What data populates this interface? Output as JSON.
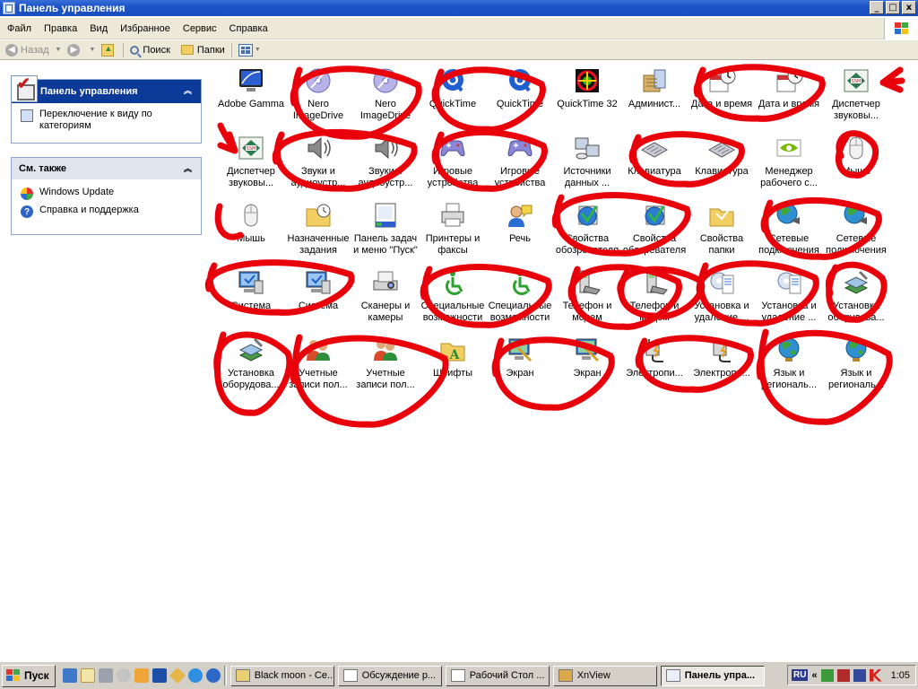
{
  "window": {
    "title": "Панель управления",
    "buttons": [
      "_",
      "□",
      "x"
    ]
  },
  "menu": [
    "Файл",
    "Правка",
    "Вид",
    "Избранное",
    "Сервис",
    "Справка"
  ],
  "toolbar": {
    "back_label": "Назад",
    "search_label": "Поиск",
    "folders_label": "Папки"
  },
  "left_pane": {
    "panel1": {
      "title": "Панель управления",
      "task": "Переключение к виду по категориям"
    },
    "panel2": {
      "title": "См. также",
      "links": [
        "Windows Update",
        "Справка и поддержка"
      ]
    }
  },
  "items": [
    {
      "label": "Adobe Gamma",
      "icon": "monitor-gamma-icon"
    },
    {
      "label": "Nero\nImageDrive",
      "icon": "nero-disc-icon"
    },
    {
      "label": "Nero\nImageDrive",
      "icon": "nero-disc-icon"
    },
    {
      "label": "QuickTime",
      "icon": "quicktime-icon"
    },
    {
      "label": "QuickTime",
      "icon": "quicktime-icon"
    },
    {
      "label": "QuickTime 32",
      "icon": "quicktime32-icon"
    },
    {
      "label": "Админист...",
      "icon": "admin-tools-icon"
    },
    {
      "label": "Дата и время",
      "icon": "date-time-icon"
    },
    {
      "label": "Дата и время",
      "icon": "date-time-icon"
    },
    {
      "label": "Диспетчер\nзвуковы...",
      "icon": "sound-manager-icon"
    },
    {
      "label": "Диспетчер\nзвуковы...",
      "icon": "sound-manager-icon"
    },
    {
      "label": "Звуки и\nаудиоустр...",
      "icon": "speaker-icon"
    },
    {
      "label": "Звуки и\nаудиоустр...",
      "icon": "speaker-icon"
    },
    {
      "label": "Игровые\nустройства",
      "icon": "gamepad-icon"
    },
    {
      "label": "Игровые\nустройства",
      "icon": "gamepad-icon"
    },
    {
      "label": "Источники\nданных ...",
      "icon": "data-sources-icon"
    },
    {
      "label": "Клавиатура",
      "icon": "keyboard-icon"
    },
    {
      "label": "Клавиатура",
      "icon": "keyboard-icon"
    },
    {
      "label": "Менеджер\nрабочего с...",
      "icon": "nvidia-icon"
    },
    {
      "label": "Мышь",
      "icon": "mouse-icon"
    },
    {
      "label": "Мышь",
      "icon": "mouse-icon"
    },
    {
      "label": "Назначенные\nзадания",
      "icon": "scheduled-tasks-icon"
    },
    {
      "label": "Панель задач\nи меню \"Пуск\"",
      "icon": "taskbar-icon"
    },
    {
      "label": "Принтеры и\nфаксы",
      "icon": "printer-icon"
    },
    {
      "label": "Речь",
      "icon": "speech-icon"
    },
    {
      "label": "Свойства\nобозревателя",
      "icon": "internet-options-icon"
    },
    {
      "label": "Свойства\nобозревателя",
      "icon": "internet-options-icon"
    },
    {
      "label": "Свойства\nпапки",
      "icon": "folder-options-icon"
    },
    {
      "label": "Сетевые\nподключения",
      "icon": "network-icon"
    },
    {
      "label": "Сетевые\nподключения",
      "icon": "network-icon"
    },
    {
      "label": "Система",
      "icon": "system-icon"
    },
    {
      "label": "Система",
      "icon": "system-icon"
    },
    {
      "label": "Сканеры и\nкамеры",
      "icon": "scanner-icon"
    },
    {
      "label": "Специальные\nвозможности",
      "icon": "accessibility-icon"
    },
    {
      "label": "Специальные\nвозможности",
      "icon": "accessibility-icon"
    },
    {
      "label": "Телефон и\nмодем",
      "icon": "phone-modem-icon"
    },
    {
      "label": "Телефон и\nмодем",
      "icon": "phone-modem-icon"
    },
    {
      "label": "Установка и\nудаление ...",
      "icon": "add-remove-icon"
    },
    {
      "label": "Установка и\nудаление ...",
      "icon": "add-remove-icon"
    },
    {
      "label": "Установка\nоборудова...",
      "icon": "add-hardware-icon"
    },
    {
      "label": "Установка\nоборудова...",
      "icon": "add-hardware-icon"
    },
    {
      "label": "Учетные\nзаписи пол...",
      "icon": "user-accounts-icon"
    },
    {
      "label": "Учетные\nзаписи пол...",
      "icon": "user-accounts-icon"
    },
    {
      "label": "Шрифты",
      "icon": "fonts-icon"
    },
    {
      "label": "Экран",
      "icon": "display-icon"
    },
    {
      "label": "Экран",
      "icon": "display-icon"
    },
    {
      "label": "Электропи...",
      "icon": "power-icon"
    },
    {
      "label": "Электропи...",
      "icon": "power-icon"
    },
    {
      "label": "Язык и\nрегиональ...",
      "icon": "globe-icon"
    },
    {
      "label": "Язык и\nрегиональ...",
      "icon": "globe-icon"
    }
  ],
  "taskbar": {
    "start_label": "Пуск",
    "buttons": [
      "Black moon - Се...",
      "Обсуждение р...",
      "Рабочий Стол ...",
      "XnView",
      "Панель упра..."
    ],
    "active_index": 4,
    "tray_lang": "RU",
    "tray_chevron": "«",
    "clock": "1:05"
  },
  "colors": {
    "title_bar": "#1c54c8",
    "chrome": "#ece9d8",
    "marker": "#e8000b",
    "panel_head": "#0c3a99"
  }
}
